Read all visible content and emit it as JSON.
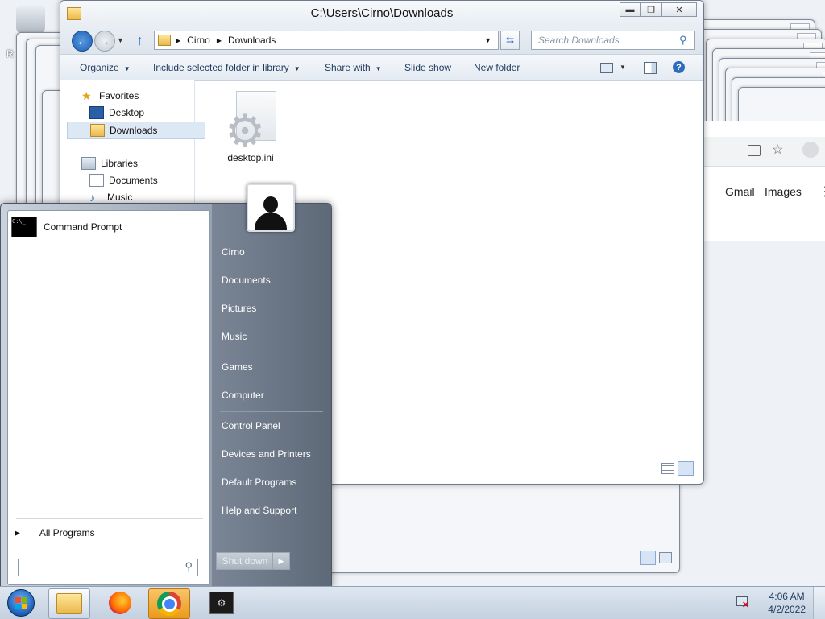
{
  "desktop": {
    "recycle_label": "R"
  },
  "explorer": {
    "title": "C:\\Users\\Cirno\\Downloads",
    "breadcrumb": [
      "Cirno",
      "Downloads"
    ],
    "search_placeholder": "Search Downloads",
    "toolbar": {
      "organize": "Organize",
      "include_library": "Include selected folder in library",
      "share_with": "Share with",
      "slide_show": "Slide show",
      "new_folder": "New folder"
    },
    "nav": {
      "favorites": "Favorites",
      "desktop": "Desktop",
      "downloads": "Downloads",
      "libraries": "Libraries",
      "documents": "Documents",
      "music": "Music"
    },
    "file_name": "desktop.ini"
  },
  "chrome": {
    "gmail": "Gmail",
    "images": "Images"
  },
  "start_menu": {
    "pinned": [
      {
        "label": "Command Prompt",
        "icon": "cmd-icon"
      }
    ],
    "all_programs": "All Programs",
    "right_links": [
      "Cirno",
      "Documents",
      "Pictures",
      "Music",
      "Games",
      "Computer",
      "Control Panel",
      "Devices and Printers",
      "Default Programs",
      "Help and Support"
    ],
    "shutdown": "Shut down"
  },
  "taskbar": {
    "icons": [
      "start-orb-icon",
      "explorer-icon",
      "firefox-icon",
      "chrome-icon",
      "program-icon"
    ],
    "time": "4:06 AM",
    "date": "4/2/2022"
  },
  "colors": {
    "accent": "#3a76c4",
    "taskbar": "#d3ddea",
    "start_right": "#6b7684"
  }
}
